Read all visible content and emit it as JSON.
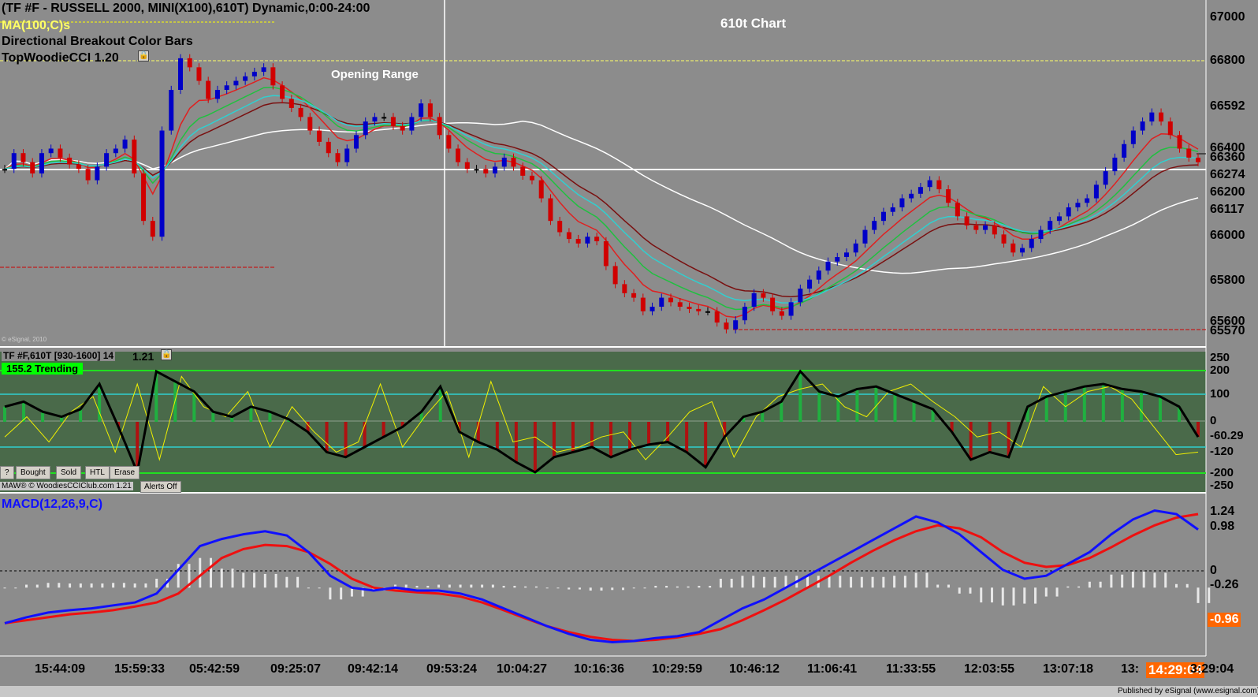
{
  "header": {
    "symbol_line": "(TF #F - RUSSELL 2000, MINI(X100),610T) Dynamic,0:00-24:00",
    "ma_study": "MA(100,C)s",
    "bar_study": "Directional Breakout Color Bars",
    "cci_study": "TopWoodieCCI 1.20"
  },
  "price_panel": {
    "chart_title": "610t Chart",
    "annotation": "Opening Range",
    "copyright": "© eSignal, 2010",
    "y_labels": [
      "67000",
      "66800",
      "66592",
      "66400",
      "66360",
      "66274",
      "66200",
      "66117",
      "66000",
      "65800",
      "65600",
      "65570"
    ]
  },
  "cci_panel": {
    "title": "TF #F,610T [930-1600] 14",
    "version": "1.21",
    "status": "155.2 Trending",
    "y_labels": [
      "250",
      "200",
      "100",
      "0",
      "-60.29",
      "-120",
      "-200",
      "-250"
    ],
    "buttons": [
      "?",
      "Bought",
      "Sold",
      "HTL",
      "Erase"
    ],
    "footer": "MAW® © WoodiesCCIClub.com 1.21",
    "alerts_button": "Alerts Off"
  },
  "macd_panel": {
    "title": "MACD(12,26,9,C)",
    "y_labels": [
      "1.24",
      "0.98",
      "0",
      "-0.26",
      "-0.96"
    ]
  },
  "time_axis": {
    "labels": [
      "15:44:09",
      "15:59:33",
      "05:42:59",
      "09:25:07",
      "09:42:14",
      "09:53:24",
      "10:04:27",
      "10:16:36",
      "10:29:59",
      "10:46:12",
      "11:06:41",
      "11:33:55",
      "12:03:55",
      "13:07:18",
      "13:",
      "3:29:04"
    ],
    "current_time": "14:29:04"
  },
  "footer": {
    "published": "Published by eSignal (www.esignal.com)"
  },
  "colors": {
    "background": "#8c8c8c",
    "cci_background": "#4a6a4a",
    "up_bar": "#0000c8",
    "down_bar": "#d00000",
    "neutral_bar": "#000000",
    "ma_white": "#ffffff",
    "ema_fast": "#e02020",
    "ema_slow": "#7a1010",
    "ema_green": "#20c040",
    "ema_cyan": "#30d0d0",
    "macd_line": "#1010ff",
    "signal_line": "#ee1010",
    "current_time_box": "#ff6600",
    "status_box": "#00ff00"
  },
  "chart_data": [
    {
      "type": "candlestick",
      "title": "610t Chart",
      "ylim": [
        65570,
        67050
      ],
      "series": [
        {
          "name": "close",
          "values": [
            66330,
            66400,
            66360,
            66310,
            66400,
            66420,
            66380,
            66350,
            66330,
            66280,
            66340,
            66400,
            66420,
            66460,
            66310,
            66100,
            66030,
            66500,
            66680,
            66820,
            66780,
            66720,
            66640,
            66680,
            66700,
            66720,
            66740,
            66760,
            66780,
            66700,
            66640,
            66600,
            66560,
            66500,
            66450,
            66400,
            66360,
            66420,
            66480,
            66540,
            66560,
            66560,
            66520,
            66500,
            66560,
            66620,
            66560,
            66480,
            66420,
            66360,
            66330,
            66330,
            66310,
            66340,
            66380,
            66340,
            66300,
            66280,
            66200,
            66100,
            66050,
            66020,
            66000,
            66030,
            66010,
            65900,
            65820,
            65780,
            65760,
            65700,
            65720,
            65760,
            65740,
            65720,
            65710,
            65700,
            65700,
            65650,
            65620,
            65660,
            65720,
            65780,
            65760,
            65700,
            65680,
            65740,
            65800,
            65840,
            65880,
            65920,
            65940,
            65960,
            66000,
            66060,
            66100,
            66140,
            66160,
            66200,
            66220,
            66250,
            66280,
            66240,
            66180,
            66120,
            66080,
            66060,
            66080,
            66040,
            66000,
            65960,
            65980,
            66020,
            66060,
            66100,
            66120,
            66160,
            66180,
            66200,
            66260,
            66320,
            66380,
            66440,
            66500,
            66540,
            66580,
            66540,
            66480,
            66420,
            66380,
            66360
          ]
        }
      ],
      "annotations": [
        "Opening Range"
      ],
      "xlabel": "",
      "ylabel": ""
    },
    {
      "type": "line",
      "title": "TF #F,610T [930-1600] 14",
      "ylim": [
        -250,
        250
      ],
      "series": [
        {
          "name": "CCI",
          "values": [
            60,
            80,
            40,
            20,
            50,
            150,
            -20,
            -200,
            200,
            160,
            120,
            40,
            20,
            60,
            40,
            10,
            -40,
            -120,
            -140,
            -100,
            -60,
            -20,
            40,
            140,
            -40,
            -80,
            -110,
            -160,
            -200,
            -140,
            -120,
            -100,
            -140,
            -110,
            -90,
            -80,
            -120,
            -180,
            -60,
            20,
            40,
            80,
            200,
            120,
            100,
            130,
            140,
            110,
            80,
            50,
            -40,
            -150,
            -120,
            -140,
            60,
            100,
            120,
            140,
            150,
            130,
            120,
            100,
            60,
            -60
          ]
        },
        {
          "name": "TCCI",
          "values": [
            -60,
            20,
            -80,
            40,
            100,
            -120,
            150,
            -150,
            180,
            60,
            20,
            120,
            -100,
            60,
            -40,
            -120,
            -80,
            150,
            -100,
            20,
            120,
            -140,
            160,
            -80,
            -60,
            -120,
            -100,
            -60,
            -40,
            -150,
            -60,
            40,
            80,
            -140,
            20,
            100,
            130,
            150,
            60,
            20,
            120,
            150,
            80,
            20,
            -60,
            -40,
            -100,
            140,
            60,
            120,
            140,
            90,
            -20,
            -130,
            -120
          ]
        }
      ]
    },
    {
      "type": "line",
      "title": "MACD(12,26,9,C)",
      "ylim": [
        -1.1,
        1.4
      ],
      "series": [
        {
          "name": "MACD",
          "values": [
            -0.6,
            -0.5,
            -0.42,
            -0.38,
            -0.35,
            -0.3,
            -0.25,
            -0.1,
            0.3,
            0.7,
            0.82,
            0.9,
            0.95,
            0.88,
            0.6,
            0.2,
            0.0,
            -0.05,
            0.0,
            -0.05,
            -0.05,
            -0.1,
            -0.2,
            -0.35,
            -0.5,
            -0.65,
            -0.78,
            -0.88,
            -0.92,
            -0.9,
            -0.85,
            -0.82,
            -0.75,
            -0.55,
            -0.35,
            -0.2,
            0.0,
            0.2,
            0.4,
            0.6,
            0.8,
            1.0,
            1.2,
            1.1,
            0.9,
            0.6,
            0.3,
            0.15,
            0.2,
            0.4,
            0.6,
            0.9,
            1.15,
            1.3,
            1.24,
            0.98
          ]
        },
        {
          "name": "Signal",
          "values": [
            -0.6,
            -0.55,
            -0.5,
            -0.45,
            -0.42,
            -0.38,
            -0.32,
            -0.25,
            -0.1,
            0.2,
            0.5,
            0.65,
            0.72,
            0.7,
            0.6,
            0.4,
            0.15,
            0.0,
            -0.05,
            -0.08,
            -0.1,
            -0.15,
            -0.25,
            -0.38,
            -0.52,
            -0.65,
            -0.75,
            -0.83,
            -0.88,
            -0.9,
            -0.88,
            -0.84,
            -0.78,
            -0.7,
            -0.55,
            -0.38,
            -0.2,
            0.0,
            0.2,
            0.42,
            0.62,
            0.8,
            0.95,
            1.05,
            1.0,
            0.85,
            0.6,
            0.42,
            0.35,
            0.38,
            0.5,
            0.68,
            0.88,
            1.05,
            1.18,
            1.24
          ]
        }
      ]
    }
  ]
}
